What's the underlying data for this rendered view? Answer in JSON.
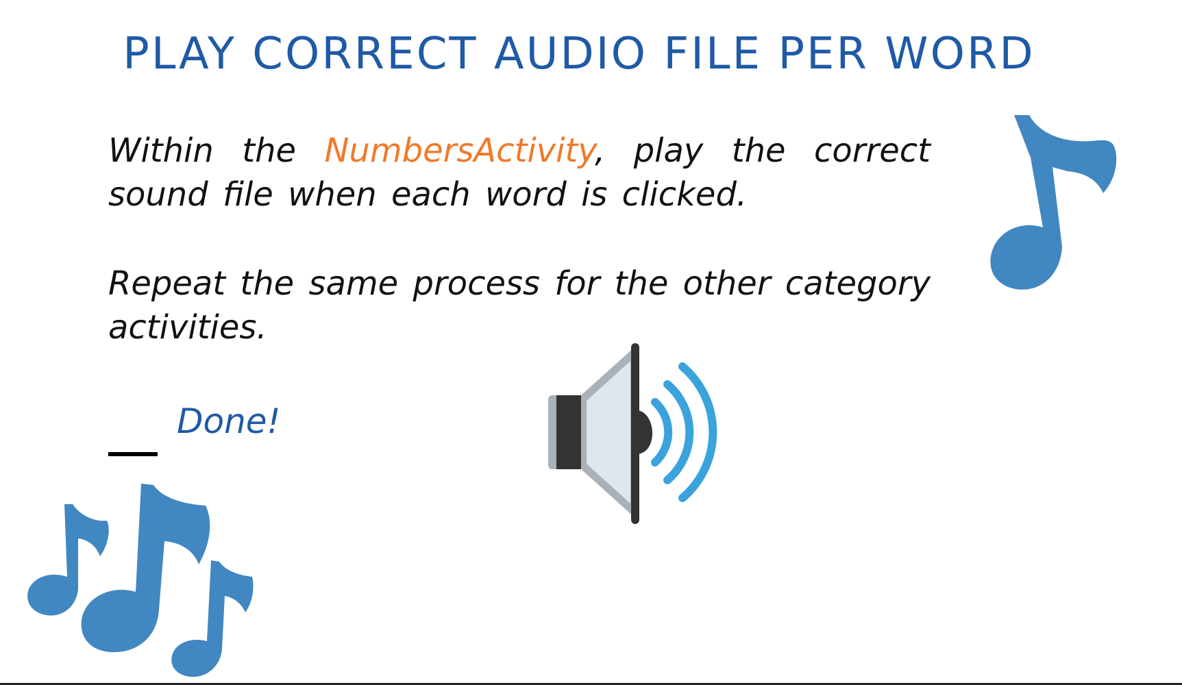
{
  "slide": {
    "title": "PLAY CORRECT AUDIO FILE PER WORD",
    "paragraph1": {
      "prefix": "Within the ",
      "highlight": "NumbersActivity",
      "suffix": ", play the correct sound file when each word is clicked."
    },
    "paragraph2": "Repeat the same process for the other category activities.",
    "checklist": {
      "done_label": "Done!"
    }
  },
  "icons": {
    "top_right": "music-note-icon",
    "bottom_left": "music-notes-icon",
    "center": "speaker-volume-icon"
  },
  "colors": {
    "title": "#1f5aa6",
    "highlight": "#f07a2a",
    "note_blue": "#4187c2",
    "wave_blue": "#3aa3dc"
  }
}
